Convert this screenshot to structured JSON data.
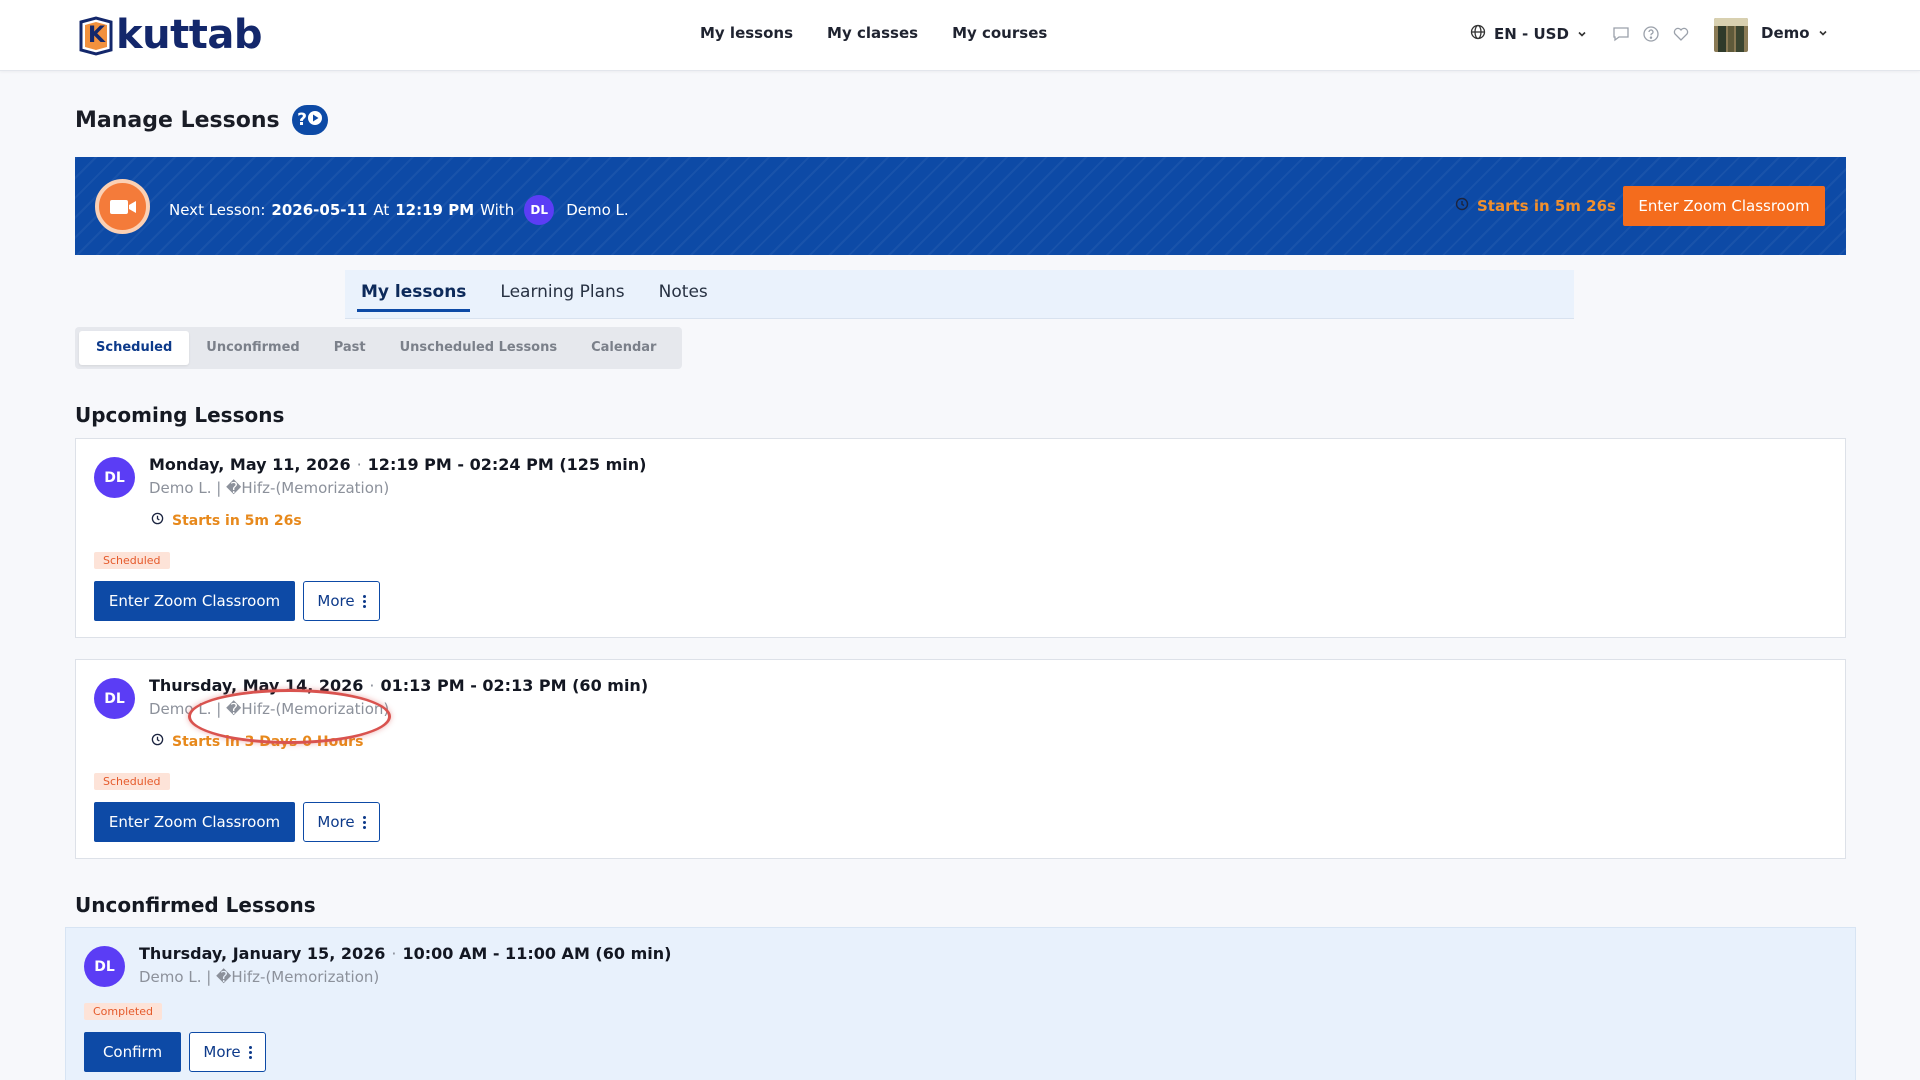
{
  "header": {
    "logo_text": "kuttab",
    "logo_letter": "K",
    "nav": [
      "My lessons",
      "My classes",
      "My courses"
    ],
    "lang": "EN - USD",
    "user": "Demo",
    "icons": [
      "globe-icon",
      "chat-icon",
      "help-circle-icon",
      "heart-icon",
      "chevron-down-icon"
    ]
  },
  "page": {
    "title": "Manage Lessons",
    "help_label": "?"
  },
  "banner": {
    "prefix": "Next Lesson:",
    "date": "2026-05-11",
    "at": "At",
    "time": "12:19 PM",
    "with": "With",
    "initials": "DL",
    "name": "Demo L.",
    "starts": "Starts in 5m 26s",
    "button": "Enter Zoom Classroom"
  },
  "tabs": [
    "My lessons",
    "Learning Plans",
    "Notes"
  ],
  "subtabs": [
    "Scheduled",
    "Unconfirmed",
    "Past",
    "Unscheduled Lessons",
    "Calendar"
  ],
  "upcoming": {
    "title": "Upcoming Lessons",
    "lessons": [
      {
        "initials": "DL",
        "date": "Monday, May 11, 2026",
        "time": "12:19 PM - 02:24 PM (125 min)",
        "sub": "Demo L. | �Hifz-(Memorization)",
        "starts": "Starts in 5m 26s",
        "badge": "Scheduled",
        "enter": "Enter Zoom Classroom",
        "more": "More"
      },
      {
        "initials": "DL",
        "date": "Thursday, May 14, 2026",
        "time": "01:13 PM - 02:13 PM (60 min)",
        "sub": "Demo L. | �Hifz-(Memorization)",
        "starts": "Starts in 3 Days 0 Hours",
        "badge": "Scheduled",
        "enter": "Enter Zoom Classroom",
        "more": "More"
      }
    ]
  },
  "unconfirmed": {
    "title": "Unconfirmed Lessons",
    "lessons": [
      {
        "initials": "DL",
        "date": "Thursday, January 15, 2026",
        "time": "10:00 AM - 11:00 AM (60 min)",
        "sub": "Demo L. | �Hifz-(Memorization)",
        "badge": "Completed",
        "confirm": "Confirm",
        "more": "More"
      }
    ]
  },
  "colors": {
    "primary": "#0d4aa6",
    "accent": "#f46c1d",
    "avatar": "#5b3df5",
    "warning": "#e7891c"
  }
}
